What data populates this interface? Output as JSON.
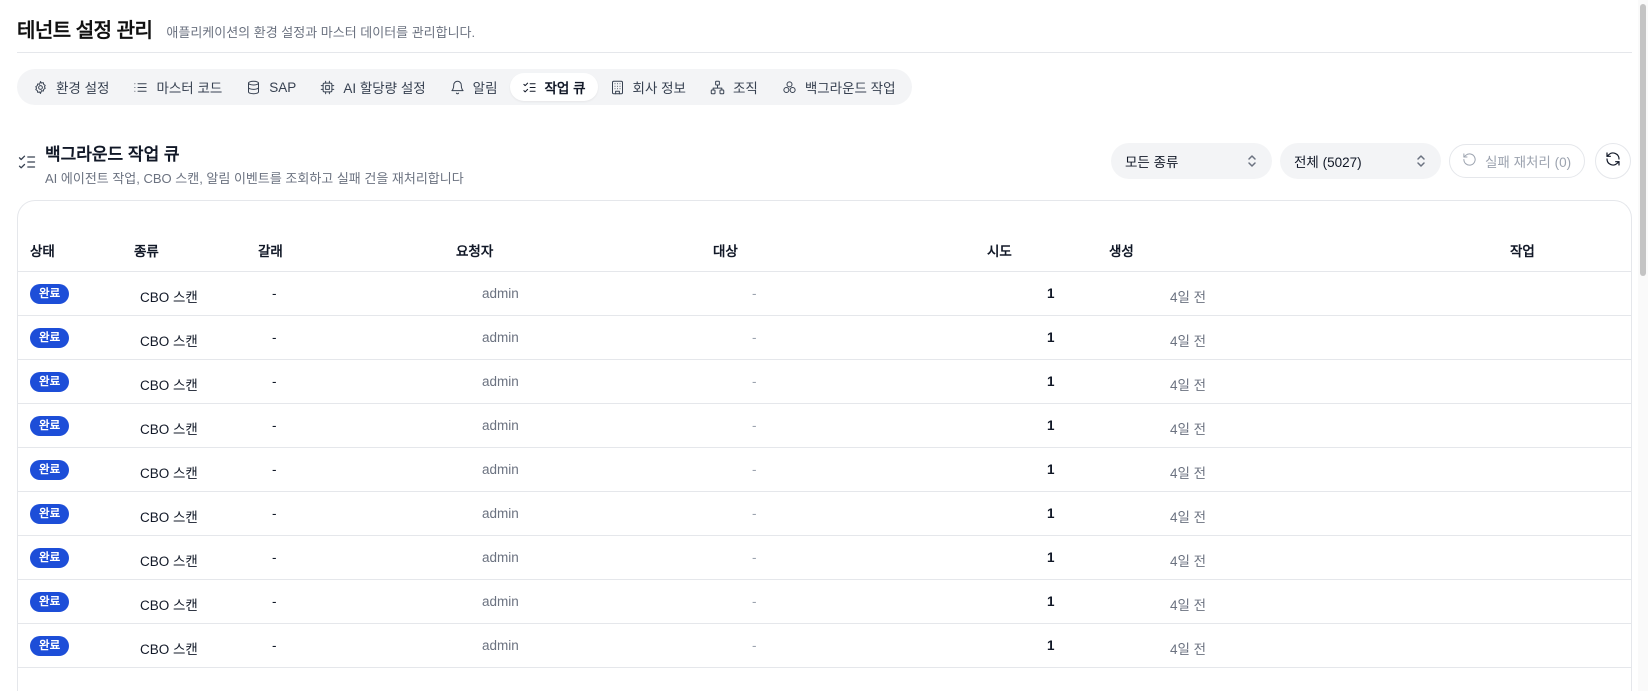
{
  "header": {
    "title": "테넌트 설정 관리",
    "subtitle": "애플리케이션의 환경 설정과 마스터 데이터를 관리합니다."
  },
  "tabs": [
    {
      "label": "환경 설정",
      "icon": "gear-icon",
      "active": false
    },
    {
      "label": "마스터 코드",
      "icon": "list-icon",
      "active": false
    },
    {
      "label": "SAP",
      "icon": "database-icon",
      "active": false
    },
    {
      "label": "AI 할당량 설정",
      "icon": "cpu-icon",
      "active": false
    },
    {
      "label": "알림",
      "icon": "bell-icon",
      "active": false
    },
    {
      "label": "작업 큐",
      "icon": "list-checks-icon",
      "active": true
    },
    {
      "label": "회사 정보",
      "icon": "building-icon",
      "active": false
    },
    {
      "label": "조직",
      "icon": "org-chart-icon",
      "active": false
    },
    {
      "label": "백그라운드 작업",
      "icon": "cogs-icon",
      "active": false
    }
  ],
  "section": {
    "title": "백그라운드 작업 큐",
    "description": "AI 에이전트 작업, CBO 스캔, 알림 이벤트를 조회하고 실패 건을 재처리합니다"
  },
  "controls": {
    "type_filter": "모든 종류",
    "status_filter": "전체 (5027)",
    "retry_button": "실패 재처리 (0)"
  },
  "table": {
    "columns": {
      "status": "상태",
      "type": "종류",
      "branch": "갈래",
      "requester": "요청자",
      "target": "대상",
      "attempts": "시도",
      "created": "생성",
      "action": "작업"
    },
    "rows": [
      {
        "status": "완료",
        "type": "CBO 스캔",
        "branch": "-",
        "requester": "admin",
        "target": "-",
        "attempts": "1",
        "created": "4일 전"
      },
      {
        "status": "완료",
        "type": "CBO 스캔",
        "branch": "-",
        "requester": "admin",
        "target": "-",
        "attempts": "1",
        "created": "4일 전"
      },
      {
        "status": "완료",
        "type": "CBO 스캔",
        "branch": "-",
        "requester": "admin",
        "target": "-",
        "attempts": "1",
        "created": "4일 전"
      },
      {
        "status": "완료",
        "type": "CBO 스캔",
        "branch": "-",
        "requester": "admin",
        "target": "-",
        "attempts": "1",
        "created": "4일 전"
      },
      {
        "status": "완료",
        "type": "CBO 스캔",
        "branch": "-",
        "requester": "admin",
        "target": "-",
        "attempts": "1",
        "created": "4일 전"
      },
      {
        "status": "완료",
        "type": "CBO 스캔",
        "branch": "-",
        "requester": "admin",
        "target": "-",
        "attempts": "1",
        "created": "4일 전"
      },
      {
        "status": "완료",
        "type": "CBO 스캔",
        "branch": "-",
        "requester": "admin",
        "target": "-",
        "attempts": "1",
        "created": "4일 전"
      },
      {
        "status": "완료",
        "type": "CBO 스캔",
        "branch": "-",
        "requester": "admin",
        "target": "-",
        "attempts": "1",
        "created": "4일 전"
      },
      {
        "status": "완료",
        "type": "CBO 스캔",
        "branch": "-",
        "requester": "admin",
        "target": "-",
        "attempts": "1",
        "created": "4일 전"
      }
    ]
  },
  "colors": {
    "badge_complete": "#1d4ed8",
    "tab_bar_bg": "#f3f4f6",
    "muted_text": "#6b7280"
  }
}
